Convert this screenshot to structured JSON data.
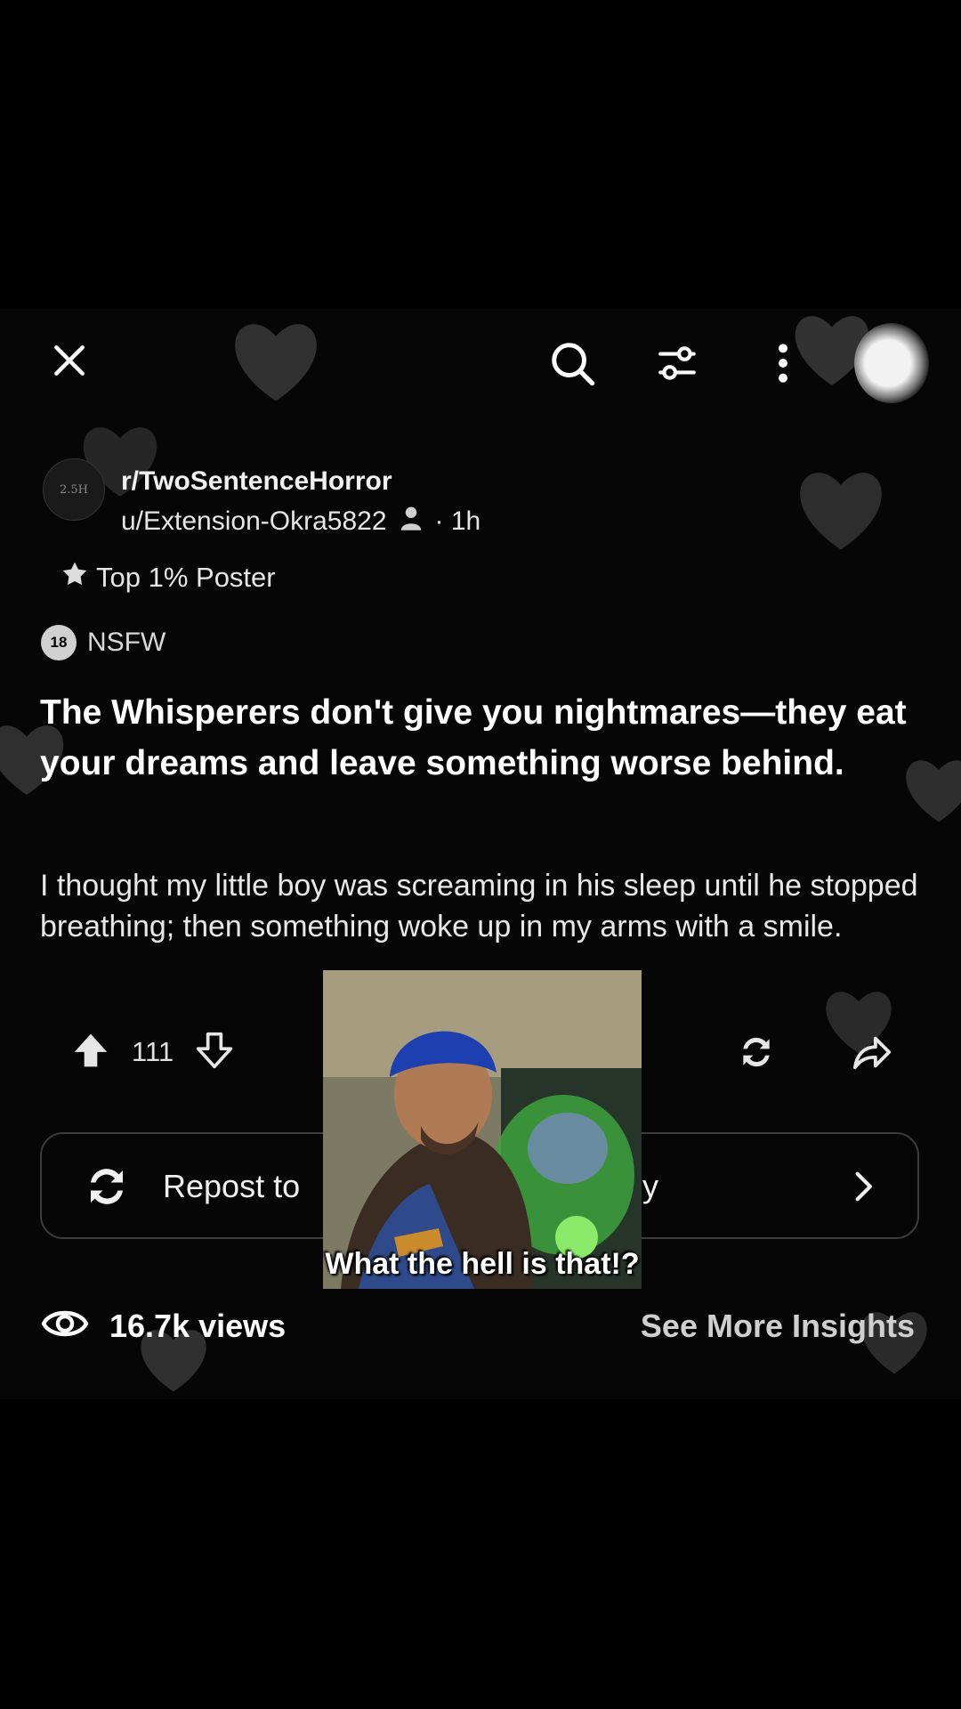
{
  "topbar": {
    "close_icon": "close-icon",
    "search_icon": "search-icon",
    "filter_icon": "sliders-icon",
    "more_icon": "more-vertical-icon",
    "avatar_icon": "user-avatar"
  },
  "post": {
    "subreddit": "r/TwoSentenceHorror",
    "subreddit_avatar_text": "2.5H",
    "author": "u/Extension-Okra5822",
    "time": "· 1h",
    "badge": "Top 1% Poster",
    "nsfw_icon_text": "18",
    "nsfw_label": "NSFW",
    "title": "The Whisperers don't give you nightmares—they eat your dreams and leave something worse behind.",
    "body": "I thought my little boy was screaming in his sleep until he stopped breathing; then something woke up in my arms with a smile."
  },
  "actions": {
    "upvotes": "111",
    "repost_label": "Repost to",
    "repost_label_end": "y"
  },
  "stats": {
    "views": "16.7k views",
    "insights": "See More Insights"
  },
  "overlay": {
    "caption": "What the hell is that!?"
  },
  "colors": {
    "background": "#000000",
    "panel": "#060606",
    "text": "#ffffff",
    "muted": "#cfcfcf",
    "border": "#3c3c3c"
  }
}
